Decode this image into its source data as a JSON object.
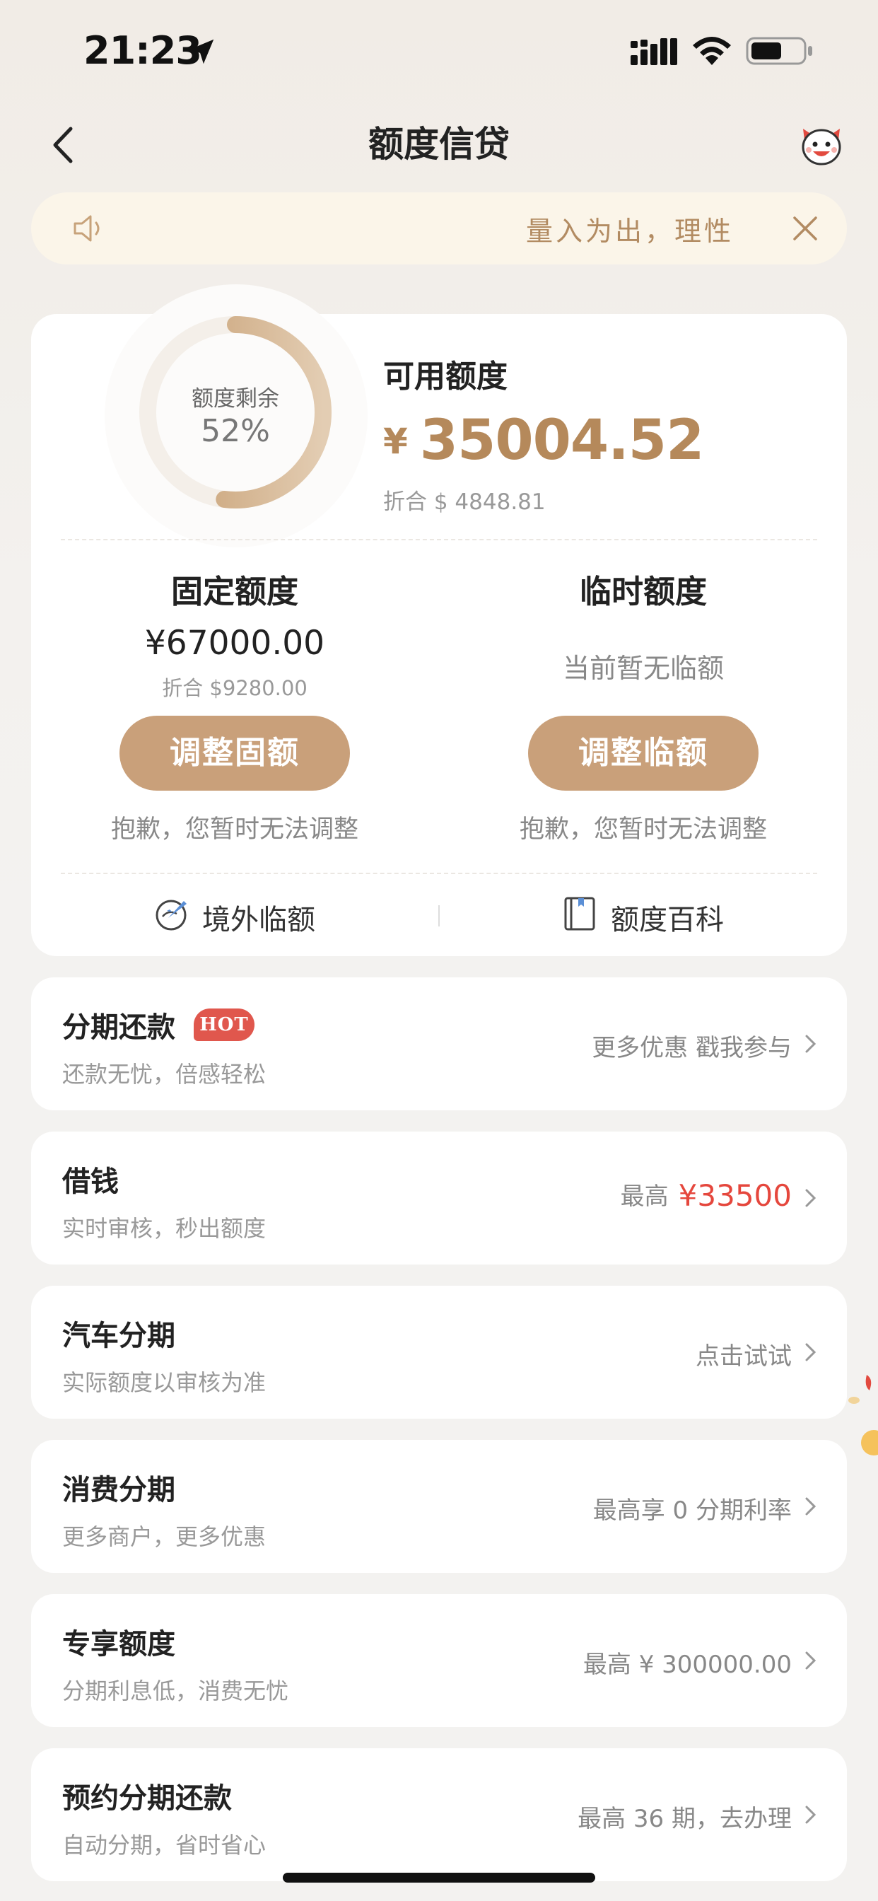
{
  "status_bar": {
    "time": "21:23"
  },
  "nav": {
    "title": "额度信贷"
  },
  "notice": {
    "text": "量入为出，理性"
  },
  "credit": {
    "ring_label": "额度剩余",
    "ring_value": "52%",
    "remaining_fraction": 0.52,
    "available_title": "可用额度",
    "currency_symbol": "¥",
    "available_amount": "35004.52",
    "available_converted": "折合 $ 4848.81",
    "fixed": {
      "title": "固定额度",
      "amount": "¥67000.00",
      "converted": "折合 $9280.00",
      "button": "调整固额",
      "note": "抱歉，您暂时无法调整"
    },
    "temporary": {
      "title": "临时额度",
      "status": "当前暂无临额",
      "button": "调整临额",
      "note": "抱歉，您暂时无法调整"
    },
    "links": [
      {
        "label": "境外临额",
        "icon": "globe-plane-icon"
      },
      {
        "label": "额度百科",
        "icon": "book-icon"
      }
    ]
  },
  "services": [
    {
      "title": "分期还款",
      "badge": "HOT",
      "subtitle": "还款无忧，倍感轻松",
      "right_text": "更多优惠 戳我参与",
      "right_highlight": ""
    },
    {
      "title": "借钱",
      "badge": "",
      "subtitle": "实时审核，秒出额度",
      "right_text": "最高",
      "right_highlight": "¥33500"
    },
    {
      "title": "汽车分期",
      "badge": "",
      "subtitle": "实际额度以审核为准",
      "right_text": "点击试试",
      "right_highlight": ""
    },
    {
      "title": "消费分期",
      "badge": "",
      "subtitle": "更多商户，更多优惠",
      "right_text": "最高享 0 分期利率",
      "right_highlight": ""
    },
    {
      "title": "专享额度",
      "badge": "",
      "subtitle": "分期利息低，消费无忧",
      "right_text": "最高 ¥ 300000.00",
      "right_highlight": ""
    },
    {
      "title": "预约分期还款",
      "badge": "",
      "subtitle": "自动分期，省时省心",
      "right_text": "最高 36 期，去办理",
      "right_highlight": ""
    }
  ],
  "colors": {
    "accent_gold": "#b5895b",
    "button_gold": "#c9a07a",
    "highlight_red": "#e5473d",
    "hot_badge": "#e0574d"
  }
}
